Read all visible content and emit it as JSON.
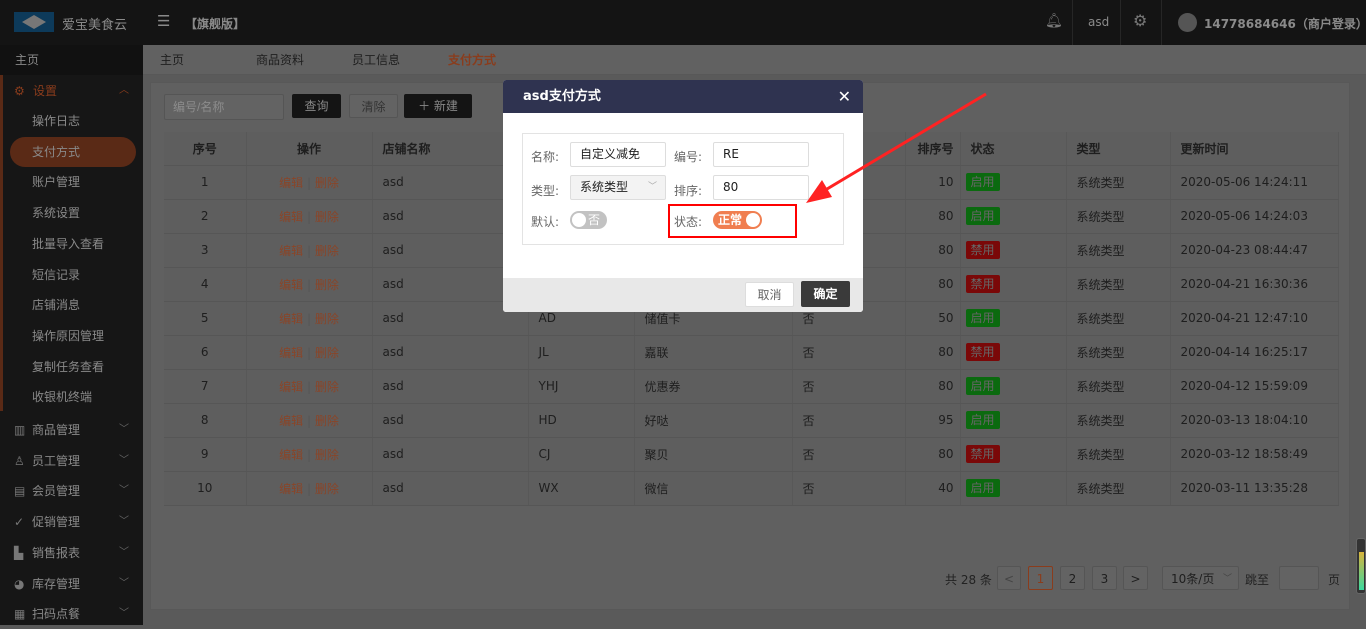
{
  "header": {
    "brand": "爱宝美食云",
    "edition": "【旗舰版】",
    "user_short": "asd",
    "account": "14778684646（商户登录）"
  },
  "sidebar": {
    "home": "主页",
    "settings": "设置",
    "settings_items": [
      "操作日志",
      "支付方式",
      "账户管理",
      "系统设置",
      "批量导入查看",
      "短信记录",
      "店铺消息",
      "操作原因管理",
      "复制任务查看",
      "收银机终端"
    ],
    "groups": [
      {
        "label": "商品管理",
        "icon": "▥"
      },
      {
        "label": "员工管理",
        "icon": "♙"
      },
      {
        "label": "会员管理",
        "icon": "▤"
      },
      {
        "label": "促销管理",
        "icon": "✓"
      },
      {
        "label": "销售报表",
        "icon": "▙"
      },
      {
        "label": "库存管理",
        "icon": "◕"
      },
      {
        "label": "扫码点餐",
        "icon": "▦"
      }
    ]
  },
  "tabs": [
    "主页",
    "商品资料",
    "员工信息",
    "支付方式"
  ],
  "toolbar": {
    "search_placeholder": "编号/名称",
    "query": "查询",
    "clear": "清除",
    "new": "新建"
  },
  "table": {
    "headers": [
      "序号",
      "操作",
      "店铺名称",
      "排序号",
      "状态",
      "类型",
      "更新时间"
    ],
    "edit": "编辑",
    "delete": "删除",
    "rows": [
      {
        "no": "1",
        "store": "asd",
        "code": "",
        "name": "",
        "def": "",
        "sort": "10",
        "status": "启用",
        "on": true,
        "type": "系统类型",
        "time": "2020-05-06 14:24:11"
      },
      {
        "no": "2",
        "store": "asd",
        "code": "",
        "name": "",
        "def": "",
        "sort": "80",
        "status": "启用",
        "on": true,
        "type": "系统类型",
        "time": "2020-05-06 14:24:03"
      },
      {
        "no": "3",
        "store": "asd",
        "code": "",
        "name": "",
        "def": "",
        "sort": "80",
        "status": "禁用",
        "on": false,
        "type": "系统类型",
        "time": "2020-04-23 08:44:47"
      },
      {
        "no": "4",
        "store": "asd",
        "code": "",
        "name": "",
        "def": "",
        "sort": "80",
        "status": "禁用",
        "on": false,
        "type": "系统类型",
        "time": "2020-04-21 16:30:36"
      },
      {
        "no": "5",
        "store": "asd",
        "code": "AD",
        "name": "储值卡",
        "def": "否",
        "sort": "50",
        "status": "启用",
        "on": true,
        "type": "系统类型",
        "time": "2020-04-21 12:47:10"
      },
      {
        "no": "6",
        "store": "asd",
        "code": "JL",
        "name": "嘉联",
        "def": "否",
        "sort": "80",
        "status": "禁用",
        "on": false,
        "type": "系统类型",
        "time": "2020-04-14 16:25:17"
      },
      {
        "no": "7",
        "store": "asd",
        "code": "YHJ",
        "name": "优惠券",
        "def": "否",
        "sort": "80",
        "status": "启用",
        "on": true,
        "type": "系统类型",
        "time": "2020-04-12 15:59:09"
      },
      {
        "no": "8",
        "store": "asd",
        "code": "HD",
        "name": "好哒",
        "def": "否",
        "sort": "95",
        "status": "启用",
        "on": true,
        "type": "系统类型",
        "time": "2020-03-13 18:04:10"
      },
      {
        "no": "9",
        "store": "asd",
        "code": "CJ",
        "name": "聚贝",
        "def": "否",
        "sort": "80",
        "status": "禁用",
        "on": false,
        "type": "系统类型",
        "time": "2020-03-12 18:58:49"
      },
      {
        "no": "10",
        "store": "asd",
        "code": "WX",
        "name": "微信",
        "def": "否",
        "sort": "40",
        "status": "启用",
        "on": true,
        "type": "系统类型",
        "time": "2020-03-11 13:35:28"
      }
    ]
  },
  "pagination": {
    "total": "共 28 条",
    "pages": [
      "1",
      "2",
      "3"
    ],
    "prev": "<",
    "next": ">",
    "page_size": "10条/页",
    "goto": "跳至",
    "page_unit": "页"
  },
  "modal": {
    "title": "asd支付方式",
    "name_label": "名称:",
    "name_value": "自定义减免",
    "code_label": "编号:",
    "code_value": "RE",
    "type_label": "类型:",
    "type_value": "系统类型",
    "sort_label": "排序:",
    "sort_value": "80",
    "default_label": "默认:",
    "default_value": "否",
    "status_label": "状态:",
    "status_value": "正常",
    "cancel": "取消",
    "ok": "确定"
  },
  "colors": {
    "accent": "#d2693c",
    "modal_header": "#2f3350",
    "switch_on": "#f07e50",
    "annotation": "#ff0000"
  }
}
